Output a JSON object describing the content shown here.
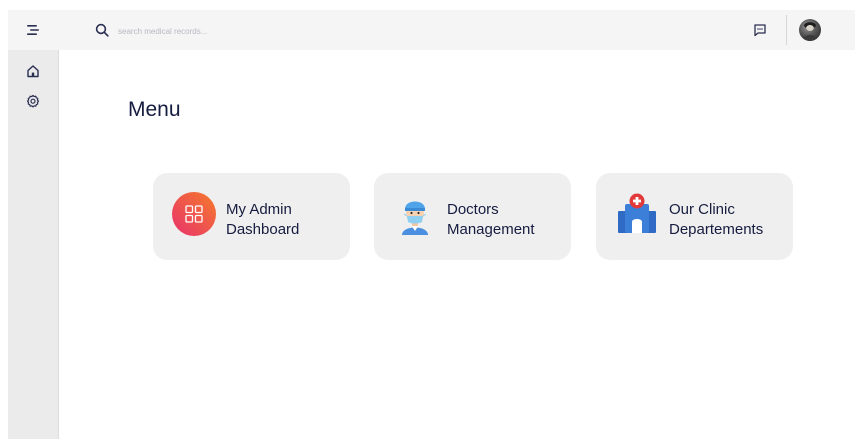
{
  "header": {
    "search": {
      "placeholder": "search medical records...",
      "value": ""
    },
    "icons": {
      "menu": "menu-lines-icon",
      "search": "search-icon",
      "chat": "chat-bubble-icon"
    }
  },
  "sidebar": {
    "items": [
      {
        "name": "home",
        "icon": "home-icon"
      },
      {
        "name": "settings",
        "icon": "gear-icon"
      }
    ]
  },
  "main": {
    "title": "Menu",
    "cards": [
      {
        "line1": "My Admin",
        "line2": "Dashboard",
        "icon": "dashboard-grid-icon"
      },
      {
        "line1": "Doctors",
        "line2": "Management",
        "icon": "doctor-icon"
      },
      {
        "line1": "Our Clinic",
        "line2": "Departements",
        "icon": "hospital-icon"
      }
    ]
  },
  "colors": {
    "title_text": "#161c3f",
    "card_bg": "#efefef",
    "sidebar_bg": "#ebebeb",
    "topbar_bg": "#f5f5f5",
    "dashboard_gradient": [
      "#e8326d",
      "#f57b2a"
    ],
    "hospital_blue": "#3b7fd8",
    "cross_red": "#e23a3a"
  }
}
